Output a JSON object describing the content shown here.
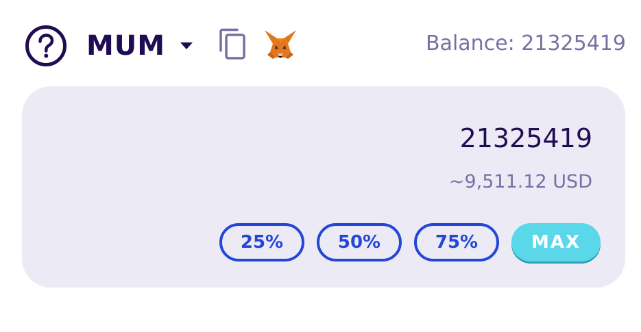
{
  "header": {
    "token_symbol": "MUM",
    "balance_text": "Balance: 21325419"
  },
  "card": {
    "amount": "21325419",
    "usd_value": "~9,511.12 USD",
    "percent_buttons": [
      {
        "label": "25%"
      },
      {
        "label": "50%"
      },
      {
        "label": "75%"
      }
    ],
    "max_label": "MAX"
  },
  "icons": {
    "help": "help-icon",
    "caret": "caret-down-icon",
    "copy": "copy-icon",
    "wallet": "metamask-fox-icon"
  },
  "colors": {
    "primary_text": "#1f0c52",
    "secondary_text": "#7a6fa4",
    "card_background": "#eceaf4",
    "percent_button": "#2346d8",
    "max_button": "#5ad8ea"
  }
}
